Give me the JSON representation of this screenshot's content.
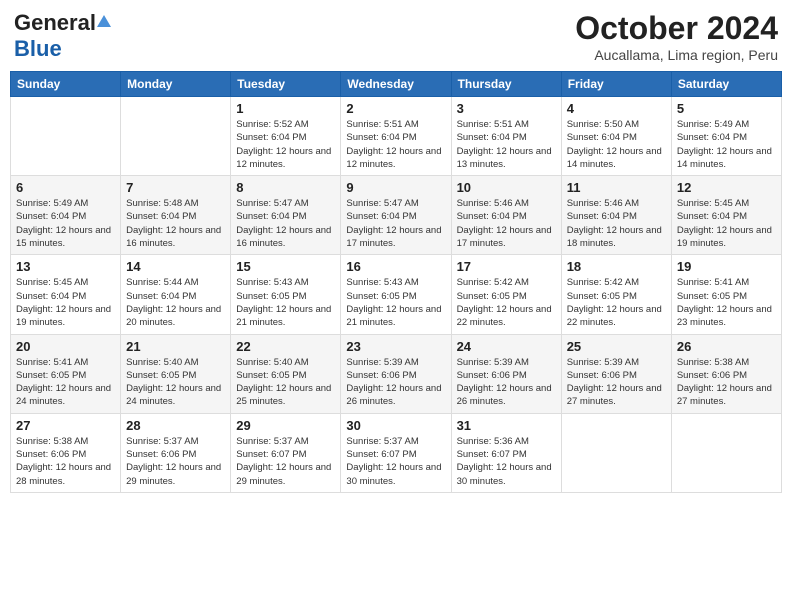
{
  "header": {
    "logo_general": "General",
    "logo_blue": "Blue",
    "month_year": "October 2024",
    "location": "Aucallama, Lima region, Peru"
  },
  "days_of_week": [
    "Sunday",
    "Monday",
    "Tuesday",
    "Wednesday",
    "Thursday",
    "Friday",
    "Saturday"
  ],
  "weeks": [
    [
      {
        "day": "",
        "info": ""
      },
      {
        "day": "",
        "info": ""
      },
      {
        "day": "1",
        "info": "Sunrise: 5:52 AM\nSunset: 6:04 PM\nDaylight: 12 hours and 12 minutes."
      },
      {
        "day": "2",
        "info": "Sunrise: 5:51 AM\nSunset: 6:04 PM\nDaylight: 12 hours and 12 minutes."
      },
      {
        "day": "3",
        "info": "Sunrise: 5:51 AM\nSunset: 6:04 PM\nDaylight: 12 hours and 13 minutes."
      },
      {
        "day": "4",
        "info": "Sunrise: 5:50 AM\nSunset: 6:04 PM\nDaylight: 12 hours and 14 minutes."
      },
      {
        "day": "5",
        "info": "Sunrise: 5:49 AM\nSunset: 6:04 PM\nDaylight: 12 hours and 14 minutes."
      }
    ],
    [
      {
        "day": "6",
        "info": "Sunrise: 5:49 AM\nSunset: 6:04 PM\nDaylight: 12 hours and 15 minutes."
      },
      {
        "day": "7",
        "info": "Sunrise: 5:48 AM\nSunset: 6:04 PM\nDaylight: 12 hours and 16 minutes."
      },
      {
        "day": "8",
        "info": "Sunrise: 5:47 AM\nSunset: 6:04 PM\nDaylight: 12 hours and 16 minutes."
      },
      {
        "day": "9",
        "info": "Sunrise: 5:47 AM\nSunset: 6:04 PM\nDaylight: 12 hours and 17 minutes."
      },
      {
        "day": "10",
        "info": "Sunrise: 5:46 AM\nSunset: 6:04 PM\nDaylight: 12 hours and 17 minutes."
      },
      {
        "day": "11",
        "info": "Sunrise: 5:46 AM\nSunset: 6:04 PM\nDaylight: 12 hours and 18 minutes."
      },
      {
        "day": "12",
        "info": "Sunrise: 5:45 AM\nSunset: 6:04 PM\nDaylight: 12 hours and 19 minutes."
      }
    ],
    [
      {
        "day": "13",
        "info": "Sunrise: 5:45 AM\nSunset: 6:04 PM\nDaylight: 12 hours and 19 minutes."
      },
      {
        "day": "14",
        "info": "Sunrise: 5:44 AM\nSunset: 6:04 PM\nDaylight: 12 hours and 20 minutes."
      },
      {
        "day": "15",
        "info": "Sunrise: 5:43 AM\nSunset: 6:05 PM\nDaylight: 12 hours and 21 minutes."
      },
      {
        "day": "16",
        "info": "Sunrise: 5:43 AM\nSunset: 6:05 PM\nDaylight: 12 hours and 21 minutes."
      },
      {
        "day": "17",
        "info": "Sunrise: 5:42 AM\nSunset: 6:05 PM\nDaylight: 12 hours and 22 minutes."
      },
      {
        "day": "18",
        "info": "Sunrise: 5:42 AM\nSunset: 6:05 PM\nDaylight: 12 hours and 22 minutes."
      },
      {
        "day": "19",
        "info": "Sunrise: 5:41 AM\nSunset: 6:05 PM\nDaylight: 12 hours and 23 minutes."
      }
    ],
    [
      {
        "day": "20",
        "info": "Sunrise: 5:41 AM\nSunset: 6:05 PM\nDaylight: 12 hours and 24 minutes."
      },
      {
        "day": "21",
        "info": "Sunrise: 5:40 AM\nSunset: 6:05 PM\nDaylight: 12 hours and 24 minutes."
      },
      {
        "day": "22",
        "info": "Sunrise: 5:40 AM\nSunset: 6:05 PM\nDaylight: 12 hours and 25 minutes."
      },
      {
        "day": "23",
        "info": "Sunrise: 5:39 AM\nSunset: 6:06 PM\nDaylight: 12 hours and 26 minutes."
      },
      {
        "day": "24",
        "info": "Sunrise: 5:39 AM\nSunset: 6:06 PM\nDaylight: 12 hours and 26 minutes."
      },
      {
        "day": "25",
        "info": "Sunrise: 5:39 AM\nSunset: 6:06 PM\nDaylight: 12 hours and 27 minutes."
      },
      {
        "day": "26",
        "info": "Sunrise: 5:38 AM\nSunset: 6:06 PM\nDaylight: 12 hours and 27 minutes."
      }
    ],
    [
      {
        "day": "27",
        "info": "Sunrise: 5:38 AM\nSunset: 6:06 PM\nDaylight: 12 hours and 28 minutes."
      },
      {
        "day": "28",
        "info": "Sunrise: 5:37 AM\nSunset: 6:06 PM\nDaylight: 12 hours and 29 minutes."
      },
      {
        "day": "29",
        "info": "Sunrise: 5:37 AM\nSunset: 6:07 PM\nDaylight: 12 hours and 29 minutes."
      },
      {
        "day": "30",
        "info": "Sunrise: 5:37 AM\nSunset: 6:07 PM\nDaylight: 12 hours and 30 minutes."
      },
      {
        "day": "31",
        "info": "Sunrise: 5:36 AM\nSunset: 6:07 PM\nDaylight: 12 hours and 30 minutes."
      },
      {
        "day": "",
        "info": ""
      },
      {
        "day": "",
        "info": ""
      }
    ]
  ]
}
